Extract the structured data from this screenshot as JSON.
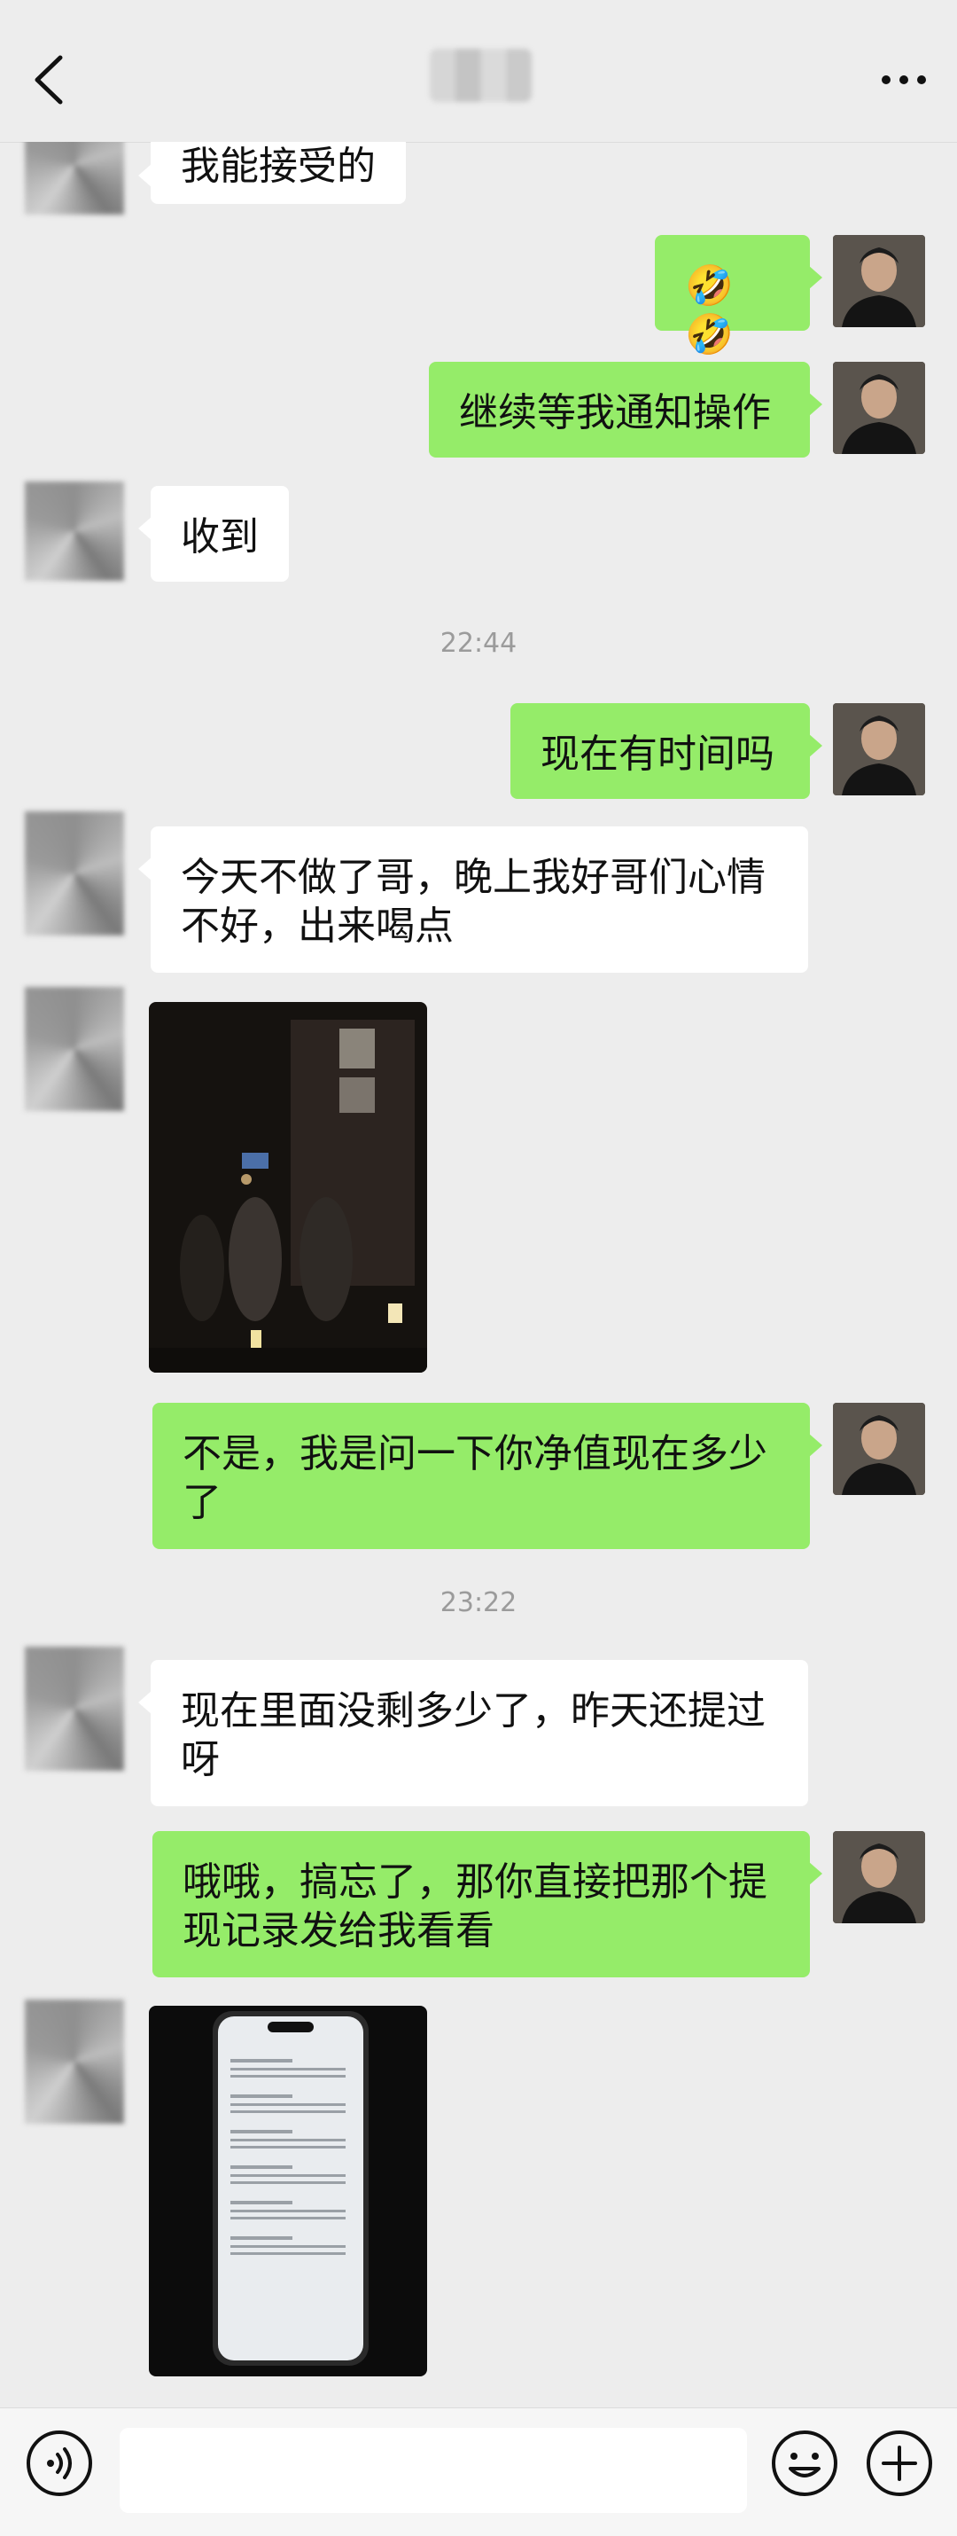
{
  "header": {
    "back_icon": "chevron-left-icon",
    "more_icon": "ellipsis-icon"
  },
  "messages": {
    "m1": "我能接受的",
    "m2": "🤣🤣",
    "m3": "继续等我通知操作",
    "m4": "收到",
    "t1": "22:44",
    "m5": "现在有时间吗",
    "m6": "今天不做了哥，晚上我好哥们心情不好，出来喝点",
    "m7": "不是，我是问一下你净值现在多少了",
    "t2": "23:22",
    "m8": "现在里面没剩多少了，昨天还提过呀",
    "m9": "哦哦，搞忘了，那你直接把那个提现记录发给我看看"
  },
  "bottom": {
    "voice_icon": "voice-icon",
    "emoji_icon": "emoji-icon",
    "plus_icon": "plus-icon"
  },
  "colors": {
    "me_bubble": "#95ec69",
    "other_bubble": "#ffffff",
    "background": "#ededed"
  }
}
